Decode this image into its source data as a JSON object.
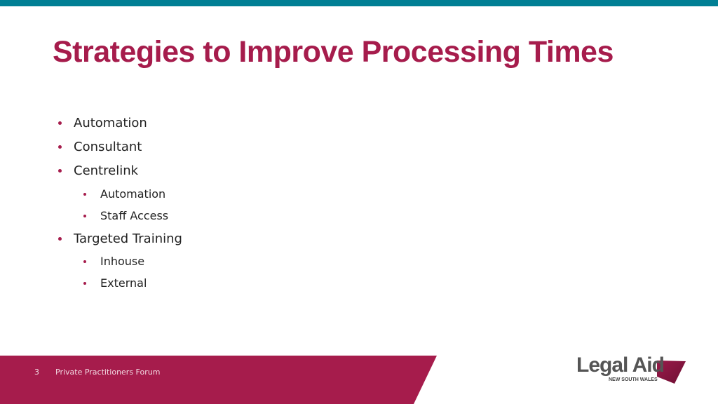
{
  "slide": {
    "title": "Strategies to Improve Processing Times",
    "bullets": [
      {
        "label": "Automation",
        "level": 1
      },
      {
        "label": "Consultant",
        "level": 1
      },
      {
        "label": "Centrelink",
        "level": 1
      },
      {
        "label": "Automation",
        "level": 2
      },
      {
        "label": "Staff Access",
        "level": 2
      },
      {
        "label": "Targeted Training",
        "level": 1
      },
      {
        "label": "Inhouse",
        "level": 2
      },
      {
        "label": "External",
        "level": 2
      }
    ]
  },
  "footer": {
    "slide_number": "3",
    "text": "Private Practitioners Forum"
  },
  "logo": {
    "name": "Legal Aid",
    "subtitle": "NEW SOUTH WALES"
  },
  "colors": {
    "accent": "#a61c4c",
    "top_bar": "#007f94",
    "text": "#222222"
  }
}
